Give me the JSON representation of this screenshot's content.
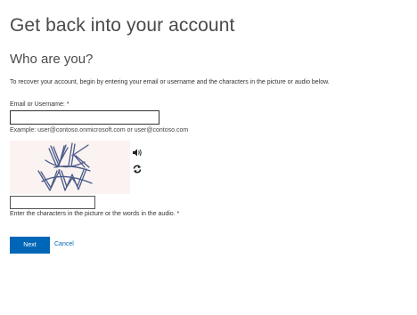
{
  "header": {
    "title": "Get back into your account",
    "subtitle": "Who are you?"
  },
  "form": {
    "intro": "To recover your account, begin by entering your email or username and the characters in the picture or audio below.",
    "username_label": "Email or Username: *",
    "username_value": "",
    "username_example": "Example: user@contoso.onmicrosoft.com or user@contoso.com",
    "captcha_text": "VKVW",
    "captcha_value": "",
    "captcha_help": "Enter the characters in the picture or the words in the audio. *",
    "next_label": "Next",
    "cancel_label": "Cancel"
  },
  "icons": {
    "audio": "speaker-icon",
    "refresh": "refresh-icon"
  },
  "colors": {
    "accent": "#0067b8",
    "captcha_background": "#fbf3f1",
    "captcha_ink": "#4a5a8a"
  }
}
